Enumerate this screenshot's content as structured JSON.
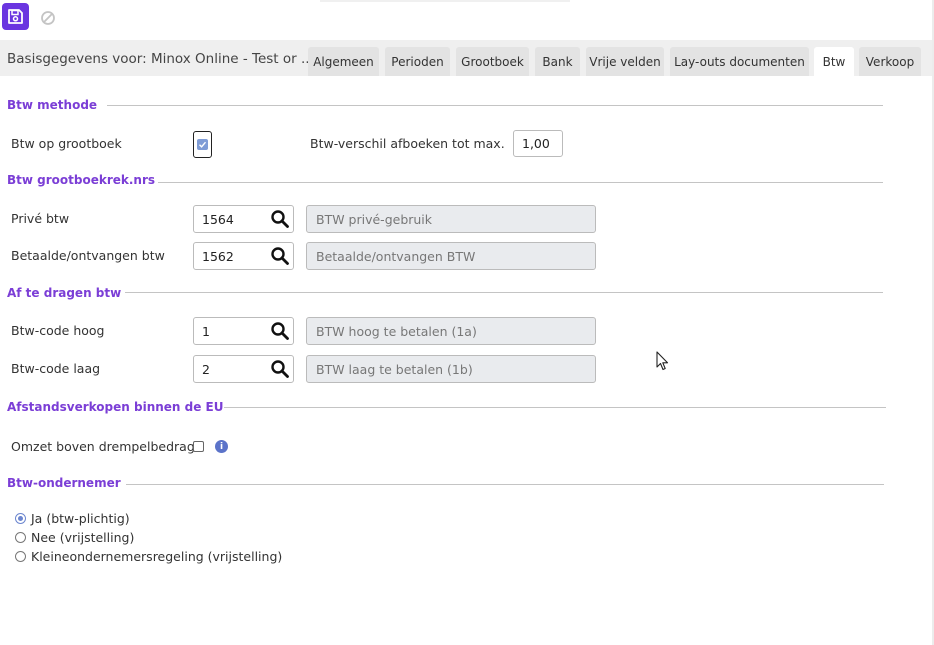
{
  "breadcrumb": "Basisgegevens voor: Minox Online - Test or ...",
  "tabs": [
    "Algemeen",
    "Perioden",
    "Grootboek",
    "Bank",
    "Vrije velden",
    "Lay-outs documenten",
    "Btw",
    "Verkoop"
  ],
  "active_tab": "Btw",
  "sections": {
    "btw_methode": {
      "title": "Btw methode",
      "btw_op_grootboek_label": "Btw op grootboek",
      "btw_op_grootboek_checked": true,
      "verschil_label": "Btw-verschil afboeken tot max.",
      "verschil_value": "1,00"
    },
    "btw_grootboek": {
      "title": "Btw grootboekrek.nrs",
      "rows": [
        {
          "label": "Privé btw",
          "code": "1564",
          "description": "BTW privé-gebruik"
        },
        {
          "label": "Betaalde/ontvangen btw",
          "code": "1562",
          "description": "Betaalde/ontvangen BTW"
        }
      ]
    },
    "af_te_dragen": {
      "title": "Af te dragen btw",
      "rows": [
        {
          "label": "Btw-code hoog",
          "code": "1",
          "description": "BTW hoog te betalen (1a)"
        },
        {
          "label": "Btw-code laag",
          "code": "2",
          "description": "BTW laag te betalen (1b)"
        }
      ]
    },
    "afstandsverkopen": {
      "title": "Afstandsverkopen binnen de EU",
      "omzet_label": "Omzet boven drempelbedrag",
      "omzet_checked": false
    },
    "ondernemer": {
      "title": "Btw-ondernemer",
      "options": [
        "Ja (btw-plichtig)",
        "Nee (vrijstelling)",
        "Kleineondernemersregeling (vrijstelling)"
      ],
      "selected": "Ja (btw-plichtig)"
    }
  },
  "colors": {
    "accent": "#6a35e0",
    "section_title": "#7b3ed6",
    "tab_bg": "#e3e3e3",
    "disabled_field": "#e9ebee"
  },
  "icons": {
    "save": "save-icon",
    "cancel": "cancel-icon",
    "search": "search-icon",
    "info": "info-icon"
  }
}
